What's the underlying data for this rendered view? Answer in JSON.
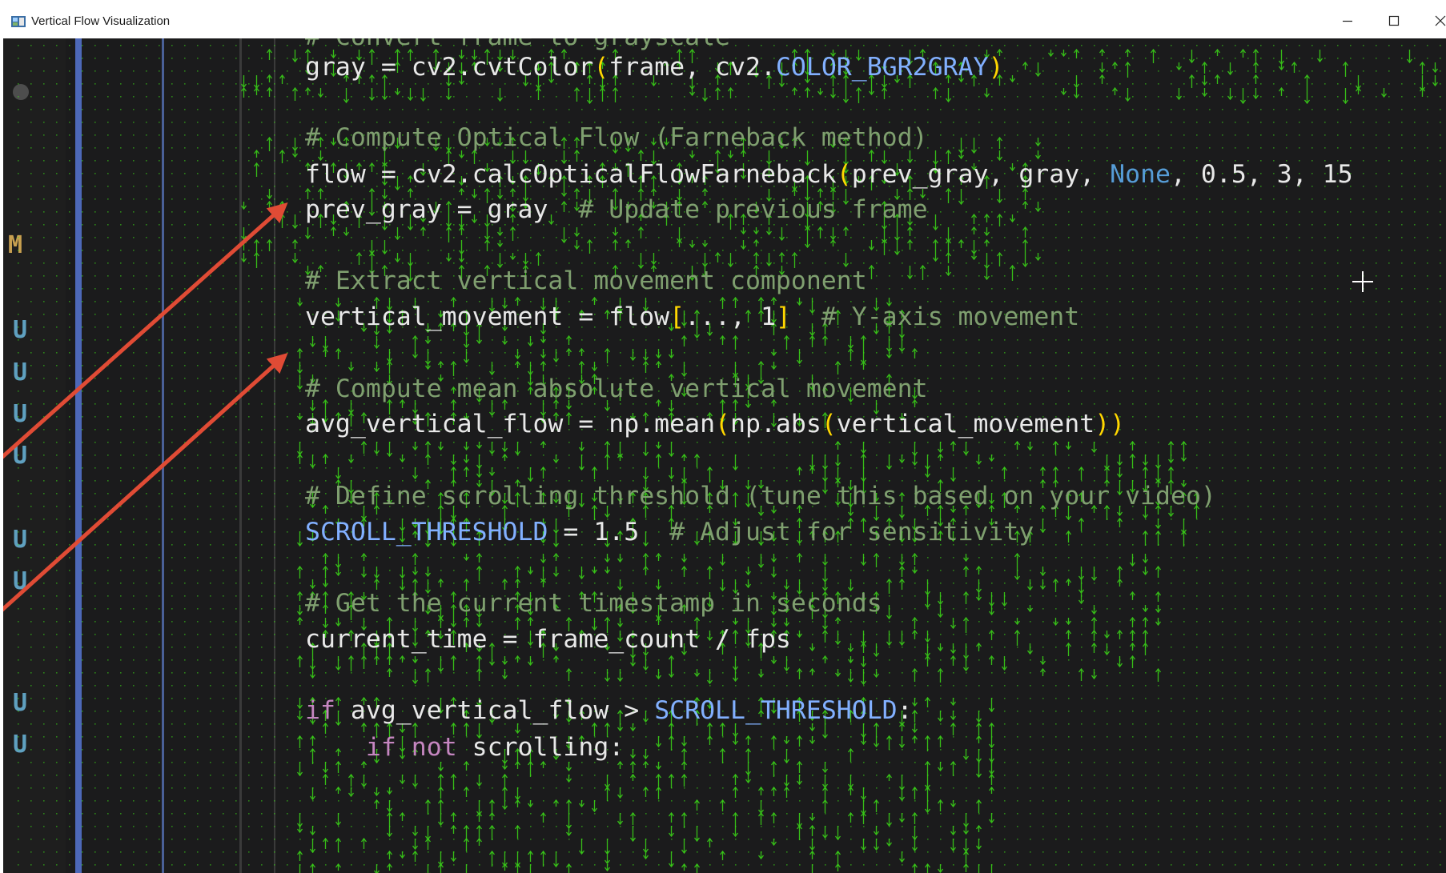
{
  "window": {
    "title": "Vertical Flow Visualization",
    "controls": {
      "minimize": "minimize-icon",
      "maximize": "maximize-icon",
      "close": "close-icon"
    }
  },
  "colors": {
    "background": "#1b1b1c",
    "gutter": "#1e1e1e",
    "flow_arrows": "#3bd818",
    "code_text": "#e8e8e8",
    "comment": "#7f9f6f",
    "keyword": "#c586c0",
    "none_keyword": "#569cd6",
    "number": "#dddddd",
    "constant": "#82b0ff",
    "bracket_yellow": "#ffd700",
    "bracket_purple": "#c77dd7",
    "annotation_arrow": "#e04b35",
    "git_marker": "#5fa0c0",
    "modified_marker": "#c8a050"
  },
  "gutter_markers": [
    "M",
    "U",
    "U",
    "U",
    "U",
    "U",
    "U",
    "U",
    "U"
  ],
  "code": [
    {
      "text": "# Convert frame to grayscale"
    },
    {
      "text": "gray = cv2.cvtColor(frame, cv2.COLOR_BGR2GRAY)"
    },
    {
      "text": "# Compute Optical Flow (Farneback method)"
    },
    {
      "text": "flow = cv2.calcOpticalFlowFarneback(prev_gray, gray, None, 0.5, 3, 15"
    },
    {
      "text": "prev_gray = gray  # Update previous frame"
    },
    {
      "text": "# Extract vertical movement component"
    },
    {
      "text": "vertical_movement = flow[..., 1]  # Y-axis movement"
    },
    {
      "text": "# Compute mean absolute vertical movement"
    },
    {
      "text": "avg_vertical_flow = np.mean(np.abs(vertical_movement))"
    },
    {
      "text": "# Define scrolling threshold (tune this based on your video)"
    },
    {
      "text": "SCROLL_THRESHOLD = 1.5  # Adjust for sensitivity"
    },
    {
      "text": "# Get the current timestamp in seconds"
    },
    {
      "text": "current_time = frame_count / fps"
    },
    {
      "text": "if avg_vertical_flow > SCROLL_THRESHOLD:"
    },
    {
      "text": "    if not scrolling:"
    }
  ]
}
